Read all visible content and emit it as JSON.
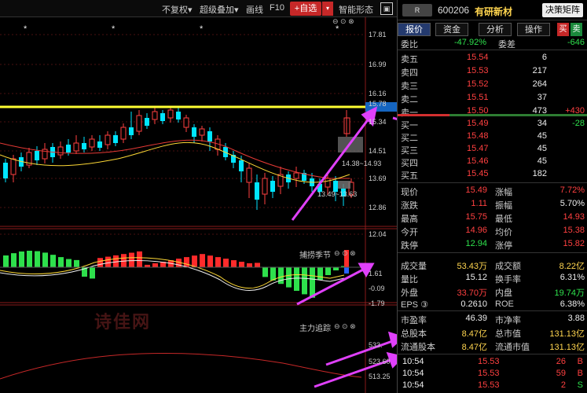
{
  "toolbar": {
    "no_adjust": "不复权▾",
    "overlay": "超级叠加▾",
    "draw_line": "画线",
    "f10": "F10",
    "add_watch": "+自选",
    "add_watch_dropdown": "▾",
    "smart_shape": "智能形态",
    "maximize": "▣"
  },
  "main_chart": {
    "price_ticks": [
      "17.81",
      "16.99",
      "16.16",
      "15.78",
      "15.34",
      "14.51",
      "13.69",
      "12.86",
      "12.04"
    ],
    "annot_high": "14.38~14.93",
    "annot_low": "13.49~13.63",
    "stars": [
      "*",
      "*",
      "*",
      "*"
    ]
  },
  "panel2": {
    "title": "捕捞季节",
    "icons": "⊖ ⊙ ⊗",
    "ticks": [
      "1.61",
      "-0.09",
      "-1.79"
    ]
  },
  "panel3": {
    "title": "主力追踪",
    "icons": "⊖ ⊙ ⊗",
    "ticks": [
      "533.",
      "523.60",
      "513.25"
    ]
  },
  "watermark": "诗佳网",
  "right_panel": {
    "badge": "R",
    "code": "600206",
    "name": "有研新材",
    "decision_button": "决策矩阵",
    "tabs": [
      "报价",
      "资金",
      "分析",
      "操作"
    ],
    "buy_tab": "买",
    "sell_tab": "卖",
    "wei_bi_label": "委比",
    "wei_bi_value": "-47.92%",
    "wei_cha_label": "委差",
    "wei_cha_value": "-646",
    "asks": [
      {
        "label": "卖五",
        "price": "15.54",
        "vol": "6",
        "chg": ""
      },
      {
        "label": "卖四",
        "price": "15.53",
        "vol": "217",
        "chg": ""
      },
      {
        "label": "卖三",
        "price": "15.52",
        "vol": "264",
        "chg": ""
      },
      {
        "label": "卖二",
        "price": "15.51",
        "vol": "37",
        "chg": ""
      },
      {
        "label": "卖一",
        "price": "15.50",
        "vol": "473",
        "chg": "+430"
      }
    ],
    "bids": [
      {
        "label": "买一",
        "price": "15.49",
        "vol": "34",
        "chg": "-28"
      },
      {
        "label": "买二",
        "price": "15.48",
        "vol": "45",
        "chg": ""
      },
      {
        "label": "买三",
        "price": "15.47",
        "vol": "45",
        "chg": ""
      },
      {
        "label": "买四",
        "price": "15.46",
        "vol": "45",
        "chg": ""
      },
      {
        "label": "买五",
        "price": "15.45",
        "vol": "182",
        "chg": ""
      }
    ],
    "stats": [
      {
        "l1": "现价",
        "v1": "15.49",
        "c1": "red",
        "l2": "涨幅",
        "v2": "7.72%",
        "c2": "red"
      },
      {
        "l1": "涨跌",
        "v1": "1.11",
        "c1": "red",
        "l2": "振幅",
        "v2": "5.70%",
        "c2": "wht"
      },
      {
        "l1": "最高",
        "v1": "15.75",
        "c1": "red",
        "l2": "最低",
        "v2": "14.93",
        "c2": "red"
      },
      {
        "l1": "今开",
        "v1": "14.96",
        "c1": "red",
        "l2": "均价",
        "v2": "15.38",
        "c2": "red"
      },
      {
        "l1": "跌停",
        "v1": "12.94",
        "c1": "grn",
        "l2": "涨停",
        "v2": "15.82",
        "c2": "red"
      }
    ],
    "vol_stats": [
      {
        "l1": "成交量",
        "v1": "53.43万",
        "c1": "yel",
        "l2": "成交额",
        "v2": "8.22亿",
        "c2": "yel"
      },
      {
        "l1": "量比",
        "v1": "15.12",
        "c1": "wht",
        "l2": "换手率",
        "v2": "6.31%",
        "c2": "wht"
      },
      {
        "l1": "外盘",
        "v1": "33.70万",
        "c1": "red",
        "l2": "内盘",
        "v2": "19.74万",
        "c2": "grn"
      },
      {
        "l1": "EPS ③",
        "v1": "0.2610",
        "c1": "wht",
        "l2": "ROE",
        "v2": "6.38%",
        "c2": "wht"
      }
    ],
    "fund_stats": [
      {
        "l1": "市盈率",
        "v1": "46.39",
        "c1": "wht",
        "l2": "市净率",
        "v2": "3.88",
        "c2": "wht"
      },
      {
        "l1": "总股本",
        "v1": "8.47亿",
        "c1": "yel",
        "l2": "总市值",
        "v2": "131.13亿",
        "c2": "yel"
      },
      {
        "l1": "流通股本",
        "v1": "8.47亿",
        "c1": "yel",
        "l2": "流通市值",
        "v2": "131.13亿",
        "c2": "yel"
      }
    ],
    "trades": [
      {
        "time": "10:54",
        "price": "15.53",
        "vol": "26",
        "side": "B"
      },
      {
        "time": "10:54",
        "price": "15.53",
        "vol": "59",
        "side": "B"
      },
      {
        "time": "10:54",
        "price": "15.53",
        "vol": "2",
        "side": "S"
      }
    ]
  },
  "colors": {
    "up": "#ff4040",
    "down": "#2ee04c",
    "yellow_line": "#ffff33",
    "arrow": "#e040fb"
  }
}
